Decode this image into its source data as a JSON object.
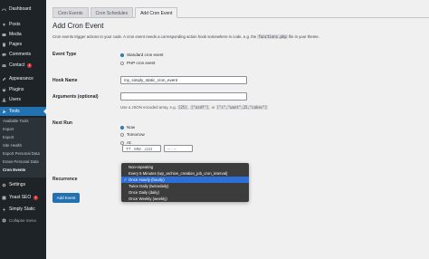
{
  "sidebar": {
    "items": [
      {
        "label": "Dashboard",
        "icon": "dashboard-icon",
        "badge": ""
      },
      {
        "label": "Posts",
        "icon": "pin-icon",
        "badge": ""
      },
      {
        "label": "Media",
        "icon": "media-icon",
        "badge": ""
      },
      {
        "label": "Pages",
        "icon": "page-icon",
        "badge": ""
      },
      {
        "label": "Comments",
        "icon": "comment-icon",
        "badge": ""
      },
      {
        "label": "Contact",
        "icon": "mail-icon",
        "badge": "1"
      },
      {
        "label": "Appearance",
        "icon": "brush-icon",
        "badge": ""
      },
      {
        "label": "Plugins",
        "icon": "plug-icon",
        "badge": ""
      },
      {
        "label": "Users",
        "icon": "user-icon",
        "badge": ""
      },
      {
        "label": "Tools",
        "icon": "wrench-icon",
        "badge": ""
      }
    ],
    "submenu": [
      "Available Tools",
      "Import",
      "Export",
      "Site Health",
      "Export Personal Data",
      "Erase Personal Data",
      "Cron Events"
    ],
    "bottom_items": [
      {
        "label": "Settings",
        "icon": "settings-icon",
        "badge": ""
      },
      {
        "label": "Yoast SEO",
        "icon": "yoast-icon",
        "badge": "1"
      },
      {
        "label": "Simply Static",
        "icon": "bolt-icon",
        "badge": ""
      },
      {
        "label": "Collapse menu",
        "icon": "collapse-icon",
        "badge": ""
      }
    ]
  },
  "tabs": [
    "Cron Events",
    "Cron Schedules",
    "Add Cron Event"
  ],
  "page": {
    "title": "Add Cron Event",
    "intro_before": "Cron events trigger actions in your code. A cron event needs a corresponding action hook somewhere in code, e.g. the",
    "intro_code": "functions.php",
    "intro_after": "file in your theme."
  },
  "form": {
    "event_type": {
      "label": "Event Type",
      "options": [
        "Standard cron event",
        "PHP cron event"
      ],
      "selected": 0
    },
    "hook_name": {
      "label": "Hook Name",
      "value": "my_simply_static_cron_event"
    },
    "arguments": {
      "label": "Arguments (optional)",
      "value": "",
      "help_before": "Use a JSON encoded array, e.g.",
      "help_code1": "[25]",
      "help_code2": "[\"asdf\"]",
      "help_or": ", or",
      "help_code3": "[\"i\",\"want\",25,\"cakes\"]"
    },
    "next_run": {
      "label": "Next Run",
      "options": [
        "Now",
        "Tomorrow",
        "At:"
      ],
      "selected": 0,
      "date_placeholder": "TT . MM . JJJJ",
      "time_placeholder": "-- : --"
    },
    "recurrence": {
      "label": "Recurrence",
      "options": [
        "Non-repeating",
        "Every 5 Minutes (wp_archive_creation_job_cron_interval)",
        "Once Hourly (hourly)",
        "Twice Daily (twicedaily)",
        "Once Daily (daily)",
        "Once Weekly (weekly)"
      ],
      "selected_index": 2,
      "check_mark": "✓"
    },
    "submit_label": "Add Event"
  }
}
